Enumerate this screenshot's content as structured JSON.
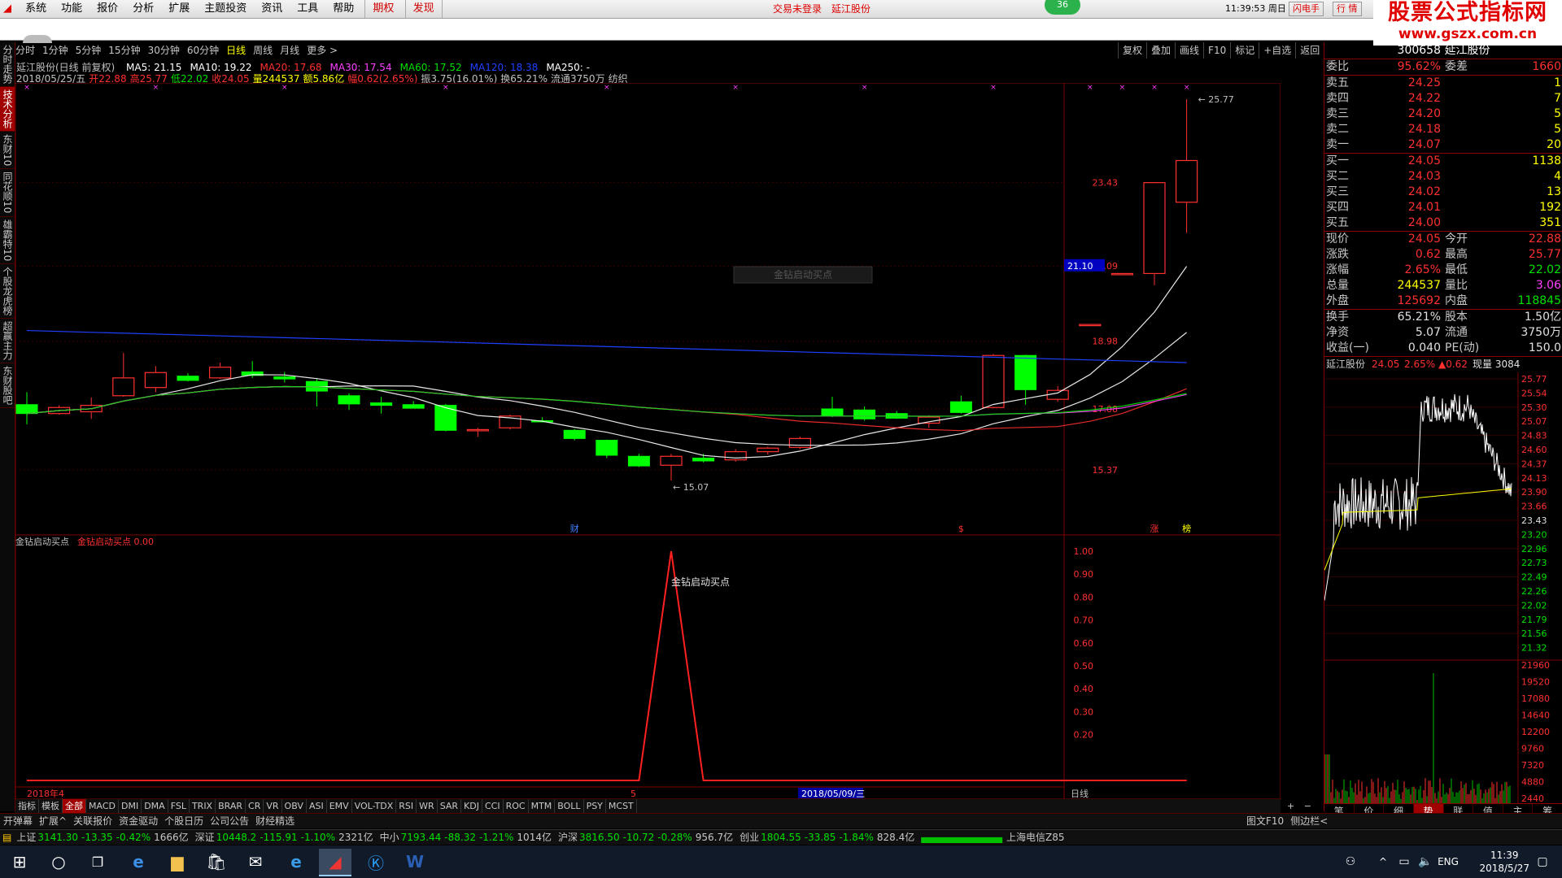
{
  "menu": {
    "items": [
      "系统",
      "功能",
      "报价",
      "分析",
      "扩展",
      "主题投资",
      "资讯",
      "工具",
      "帮助"
    ],
    "extra": [
      "期权",
      "发现"
    ],
    "status_login": "交易未登录",
    "stock_name": "延江股份",
    "badge": "36",
    "time": "11:39:53 周日",
    "buttons": [
      "闪电手",
      "行 情"
    ]
  },
  "brand": {
    "title": "股票公式指标网",
    "url": "www.gszx.com.cn"
  },
  "left_tabs": [
    "分时走势",
    "技术分析",
    "东财10",
    "同花顺10",
    "雄霸特10",
    "个股龙虎榜",
    "超赢主力",
    "东财股吧"
  ],
  "period_bar": [
    "分时",
    "1分钟",
    "5分钟",
    "15分钟",
    "30分钟",
    "60分钟",
    "日线",
    "周线",
    "月线",
    "更多 >"
  ],
  "period_selected": "日线",
  "right_tools": [
    "复权",
    "叠加",
    "画线",
    "F10",
    "标记",
    "+自选",
    "返回"
  ],
  "chart_header": {
    "title": "延江股份(日线 前复权)",
    "ma": [
      {
        "label": "MA5: 21.15",
        "color": "#ffffff"
      },
      {
        "label": "MA10: 19.22",
        "color": "#ffffff"
      },
      {
        "label": "MA20: 17.68",
        "color": "#ff3030"
      },
      {
        "label": "MA30: 17.54",
        "color": "#ff40ff"
      },
      {
        "label": "MA60: 17.52",
        "color": "#00e000"
      },
      {
        "label": "MA120: 18.38",
        "color": "#2040ff"
      },
      {
        "label": "MA250: -",
        "color": "#ffffff"
      }
    ],
    "ohlc": [
      {
        "label": "2018/05/25/五",
        "color": "#c0c0c0"
      },
      {
        "label": "开22.88",
        "color": "#ff3030"
      },
      {
        "label": "高25.77",
        "color": "#ff3030"
      },
      {
        "label": "低22.02",
        "color": "#00e000"
      },
      {
        "label": "收24.05",
        "color": "#ff3030"
      },
      {
        "label": "量244537",
        "color": "#ffff00"
      },
      {
        "label": "额5.86亿",
        "color": "#ffff00"
      },
      {
        "label": "幅0.62(2.65%)",
        "color": "#ff3030"
      },
      {
        "label": "振3.75(16.01%)",
        "color": "#c0c0c0"
      },
      {
        "label": "换65.21%",
        "color": "#c0c0c0"
      },
      {
        "label": "流通3750万",
        "color": "#c0c0c0"
      },
      {
        "label": "纺织",
        "color": "#c0c0c0"
      }
    ]
  },
  "chart_data": [
    {
      "type": "candlestick",
      "yaxis_ticks": [
        "23.43",
        "21.09",
        "18.98",
        "17.08",
        "15.37"
      ],
      "current_price_tag": "21.10",
      "annotations": {
        "high": "25.77",
        "low": "15.07"
      },
      "bottom_markers": [
        "财",
        "$",
        "涨",
        "榜"
      ],
      "overlay_text": "金钻启动买点",
      "candles": [
        {
          "o": 17.2,
          "h": 17.55,
          "l": 16.65,
          "c": 16.95
        },
        {
          "o": 16.95,
          "h": 17.18,
          "l": 16.92,
          "c": 17.12
        },
        {
          "o": 17.0,
          "h": 17.4,
          "l": 16.8,
          "c": 17.18
        },
        {
          "o": 17.45,
          "h": 18.65,
          "l": 17.42,
          "c": 17.95
        },
        {
          "o": 17.68,
          "h": 18.28,
          "l": 17.55,
          "c": 18.1
        },
        {
          "o": 18.0,
          "h": 18.08,
          "l": 17.85,
          "c": 17.88
        },
        {
          "o": 17.95,
          "h": 18.38,
          "l": 17.92,
          "c": 18.25
        },
        {
          "o": 18.12,
          "h": 18.42,
          "l": 17.95,
          "c": 18.02
        },
        {
          "o": 17.98,
          "h": 18.12,
          "l": 17.82,
          "c": 17.92
        },
        {
          "o": 17.85,
          "h": 17.92,
          "l": 17.15,
          "c": 17.58
        },
        {
          "o": 17.45,
          "h": 17.52,
          "l": 17.05,
          "c": 17.22
        },
        {
          "o": 17.25,
          "h": 17.42,
          "l": 16.95,
          "c": 17.18
        },
        {
          "o": 17.2,
          "h": 17.3,
          "l": 17.15,
          "c": 17.1
        },
        {
          "o": 17.18,
          "h": 17.22,
          "l": 16.45,
          "c": 16.48
        },
        {
          "o": 16.48,
          "h": 16.55,
          "l": 16.3,
          "c": 16.5
        },
        {
          "o": 16.55,
          "h": 16.92,
          "l": 16.5,
          "c": 16.88
        },
        {
          "o": 16.75,
          "h": 16.85,
          "l": 16.7,
          "c": 16.72
        },
        {
          "o": 16.48,
          "h": 16.52,
          "l": 16.2,
          "c": 16.25
        },
        {
          "o": 16.2,
          "h": 16.22,
          "l": 15.7,
          "c": 15.78
        },
        {
          "o": 15.75,
          "h": 15.82,
          "l": 15.45,
          "c": 15.48
        },
        {
          "o": 15.5,
          "h": 15.82,
          "l": 15.07,
          "c": 15.75
        },
        {
          "o": 15.7,
          "h": 15.82,
          "l": 15.58,
          "c": 15.62
        },
        {
          "o": 15.65,
          "h": 15.95,
          "l": 15.6,
          "c": 15.88
        },
        {
          "o": 15.88,
          "h": 16.02,
          "l": 15.8,
          "c": 15.98
        },
        {
          "o": 16.0,
          "h": 16.3,
          "l": 15.95,
          "c": 16.25
        },
        {
          "o": 17.08,
          "h": 17.42,
          "l": 16.85,
          "c": 16.88
        },
        {
          "o": 17.05,
          "h": 17.15,
          "l": 16.75,
          "c": 16.8
        },
        {
          "o": 16.95,
          "h": 17.02,
          "l": 16.8,
          "c": 16.82
        },
        {
          "o": 16.68,
          "h": 16.9,
          "l": 16.55,
          "c": 16.85
        },
        {
          "o": 17.28,
          "h": 17.45,
          "l": 16.95,
          "c": 16.98
        },
        {
          "o": 17.12,
          "h": 18.62,
          "l": 17.1,
          "c": 18.58
        },
        {
          "o": 18.58,
          "h": 18.6,
          "l": 17.2,
          "c": 17.62
        },
        {
          "o": 17.35,
          "h": 17.72,
          "l": 17.28,
          "c": 17.6
        },
        {
          "o": 19.45,
          "h": 19.45,
          "l": 19.45,
          "c": 19.45
        },
        {
          "o": 20.88,
          "h": 20.88,
          "l": 20.88,
          "c": 20.88
        },
        {
          "o": 20.88,
          "h": 23.43,
          "l": 20.55,
          "c": 23.43
        },
        {
          "o": 22.88,
          "h": 25.77,
          "l": 22.02,
          "c": 24.05
        }
      ]
    },
    {
      "type": "line",
      "title": "金钻启动买点",
      "legend": "金钻启动买点 0.00",
      "yaxis_ticks": [
        "1.00",
        "0.90",
        "0.80",
        "0.70",
        "0.60",
        "0.50",
        "0.40",
        "0.30",
        "0.20"
      ],
      "peak_label": "金钻启动买点",
      "signal": [
        0,
        0,
        0,
        0,
        0,
        0,
        0,
        0,
        0,
        0,
        0,
        0,
        0,
        0,
        0,
        0,
        0,
        0,
        0,
        0,
        1,
        0,
        0,
        0,
        0,
        0,
        0,
        0,
        0,
        0,
        0,
        0,
        0,
        0,
        0,
        0,
        0
      ],
      "x_labels": [
        "2018年4",
        "5",
        "2018/05/09/三"
      ],
      "x_right": "日线"
    }
  ],
  "quote_panel": {
    "code_name": "300658 延江股份",
    "weibi": {
      "label": "委比",
      "value": "95.62%",
      "label2": "委差",
      "value2": "1660"
    },
    "sells": [
      {
        "label": "卖五",
        "price": "24.25",
        "vol": "1"
      },
      {
        "label": "卖四",
        "price": "24.22",
        "vol": "7"
      },
      {
        "label": "卖三",
        "price": "24.20",
        "vol": "5"
      },
      {
        "label": "卖二",
        "price": "24.18",
        "vol": "5"
      },
      {
        "label": "卖一",
        "price": "24.07",
        "vol": "20"
      }
    ],
    "buys": [
      {
        "label": "买一",
        "price": "24.05",
        "vol": "1138"
      },
      {
        "label": "买二",
        "price": "24.03",
        "vol": "4"
      },
      {
        "label": "买三",
        "price": "24.02",
        "vol": "13"
      },
      {
        "label": "买四",
        "price": "24.01",
        "vol": "192"
      },
      {
        "label": "买五",
        "price": "24.00",
        "vol": "351"
      }
    ],
    "stats1": [
      {
        "l1": "现价",
        "v1": "24.05",
        "c1": "red",
        "l2": "今开",
        "v2": "22.88",
        "c2": "red"
      },
      {
        "l1": "涨跌",
        "v1": "0.62",
        "c1": "red",
        "l2": "最高",
        "v2": "25.77",
        "c2": "red"
      },
      {
        "l1": "涨幅",
        "v1": "2.65%",
        "c1": "red",
        "l2": "最低",
        "v2": "22.02",
        "c2": "grn"
      },
      {
        "l1": "总量",
        "v1": "244537",
        "c1": "yel",
        "l2": "量比",
        "v2": "3.06",
        "c2": "mag"
      },
      {
        "l1": "外盘",
        "v1": "125692",
        "c1": "red",
        "l2": "内盘",
        "v2": "118845",
        "c2": "grn"
      }
    ],
    "stats2": [
      {
        "l1": "换手",
        "v1": "65.21%",
        "l2": "股本",
        "v2": "1.50亿"
      },
      {
        "l1": "净资",
        "v1": "5.07",
        "l2": "流通",
        "v2": "3750万"
      },
      {
        "l1": "收益(一)",
        "v1": "0.040",
        "l2": "PE(动)",
        "v2": "150.0"
      }
    ],
    "mini_header": {
      "name": "延江股份",
      "price": "24.05",
      "pct": "2.65%",
      "chg": "▲0.62",
      "vol": "现量 3084"
    },
    "mini_price_ticks": [
      "25.77",
      "25.54",
      "25.30",
      "25.07",
      "24.83",
      "24.60",
      "24.37",
      "24.13",
      "23.90",
      "23.66",
      "23.43",
      "23.20",
      "22.96",
      "22.73",
      "22.49",
      "22.26",
      "22.02",
      "21.79",
      "21.56",
      "21.32"
    ],
    "mini_vol_ticks": [
      "21960",
      "19520",
      "17080",
      "14640",
      "12200",
      "9760",
      "7320",
      "4880",
      "2440"
    ],
    "tabs": [
      "笔",
      "价",
      "细",
      "势",
      "联",
      "值",
      "主",
      "筹"
    ],
    "active_tab": "势"
  },
  "indicator_tabs": [
    "指标",
    "模板",
    "全部",
    "MACD",
    "DMI",
    "DMA",
    "FSL",
    "TRIX",
    "BRAR",
    "CR",
    "VR",
    "OBV",
    "ASI",
    "EMV",
    "VOL-TDX",
    "RSI",
    "WR",
    "SAR",
    "KDJ",
    "CCI",
    "ROC",
    "MTM",
    "BOLL",
    "PSY",
    "MCST"
  ],
  "indicator_selected": "全部",
  "func_bar": [
    "开弹幕",
    "扩展^",
    "关联报价",
    "资金驱动",
    "个股日历",
    "公司公告",
    "财经精选"
  ],
  "func_right": [
    "图文F10",
    "侧边栏<"
  ],
  "ticker": [
    {
      "name": "上证",
      "val": "3141.30",
      "chg": "-13.35",
      "pct": "-0.42%",
      "amt": "1666亿"
    },
    {
      "name": "深证",
      "val": "10448.2",
      "chg": "-115.91",
      "pct": "-1.10%",
      "amt": "2321亿"
    },
    {
      "name": "中小",
      "val": "7193.44",
      "chg": "-88.32",
      "pct": "-1.21%",
      "amt": "1014亿"
    },
    {
      "name": "沪深",
      "val": "3816.50",
      "chg": "-10.72",
      "pct": "-0.28%",
      "amt": "956.7亿"
    },
    {
      "name": "创业",
      "val": "1804.55",
      "chg": "-33.85",
      "pct": "-1.84%",
      "amt": "828.4亿"
    }
  ],
  "ticker_server": "上海电信Z85",
  "taskbar": {
    "lang": "ENG",
    "time": "11:39",
    "date": "2018/5/27"
  }
}
